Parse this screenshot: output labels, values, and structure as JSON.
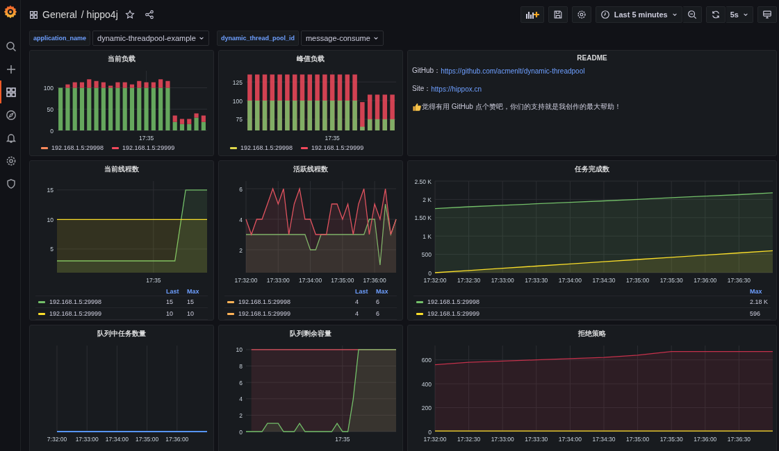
{
  "sidebar": {
    "items": [
      {
        "kind": "search",
        "selected": false
      },
      {
        "kind": "create",
        "selected": false
      },
      {
        "kind": "dashboards",
        "selected": true
      },
      {
        "kind": "explore",
        "selected": false
      },
      {
        "kind": "alerting",
        "selected": false
      },
      {
        "kind": "configuration",
        "selected": false
      },
      {
        "kind": "admin",
        "selected": false
      }
    ]
  },
  "breadcrumb": [
    "General",
    "/ hippo4j"
  ],
  "time_picker": {
    "label": "Last 5 minutes"
  },
  "refresh": {
    "interval": "5s"
  },
  "variables": [
    {
      "label": "application_name",
      "value": "dynamic-threadpool-example"
    },
    {
      "label": "dynamic_thread_pool_id",
      "value": "message-consume"
    }
  ],
  "panels": [
    {
      "kind": "chart",
      "title": "当前负载",
      "chart_data": {
        "type": "bar",
        "grid": true,
        "stacked": true,
        "categories": [
          null,
          null,
          null,
          null,
          null,
          null,
          null,
          null,
          null,
          null,
          null,
          null,
          "17:35",
          null,
          null,
          null,
          null,
          null,
          null,
          null,
          null
        ],
        "ylim": [
          0,
          140
        ],
        "yticks": [
          0,
          50,
          100
        ],
        "series": [
          {
            "name": "192.168.1.5:29998",
            "color": "#73bf69",
            "values": [
              100,
              100,
              100,
              100,
              100,
              100,
              100,
              100,
              100,
              100,
              100,
              100,
              100,
              100,
              100,
              100,
              20,
              15,
              15,
              30,
              20
            ]
          },
          {
            "name": "192.168.1.5:29999",
            "color": "#f2495c",
            "values": [
              0,
              8,
              13,
              13,
              20,
              16,
              13,
              5,
              13,
              13,
              8,
              16,
              13,
              13,
              20,
              16,
              15,
              12,
              12,
              10,
              15
            ]
          }
        ]
      },
      "legend": {
        "kind": "inline",
        "items": [
          {
            "color": "#ff8a5c"
          },
          {
            "color": "#f2495c"
          }
        ]
      }
    },
    {
      "kind": "chart",
      "title": "峰值负载",
      "chart_data": {
        "type": "bar",
        "grid": true,
        "stacked": false,
        "categories": [
          null,
          null,
          null,
          null,
          null,
          null,
          null,
          null,
          null,
          null,
          null,
          "17:35",
          null,
          null,
          null,
          null,
          null,
          null,
          null,
          null
        ],
        "ylim": [
          60,
          140
        ],
        "yticks": [
          75,
          100,
          125
        ],
        "series": [
          {
            "name": "192.168.1.5:29998",
            "color": "#73bf69",
            "values": [
              100,
              100,
              100,
              100,
              100,
              100,
              100,
              100,
              100,
              100,
              100,
              100,
              100,
              100,
              100,
              65,
              75,
              75,
              75,
              75
            ]
          },
          {
            "name": "192.168.1.5:29999",
            "color": "#f2495c",
            "values": [
              135,
              135,
              135,
              135,
              135,
              135,
              135,
              135,
              135,
              135,
              135,
              135,
              135,
              135,
              135,
              98,
              108,
              108,
              108,
              108
            ]
          }
        ]
      },
      "legend": {
        "kind": "inline",
        "items": [
          {
            "color": "#e0d84a"
          },
          {
            "color": "#f2495c"
          }
        ]
      }
    },
    {
      "kind": "text",
      "title": "README",
      "lines": [
        {
          "kind": "link",
          "label": "GitHub：",
          "link": "https://github.com/acmenlt/dynamic-threadpool"
        },
        {
          "kind": "link",
          "label": "Site：",
          "link": "https://hippox.cn"
        },
        {
          "kind": "note",
          "text": "觉得有用 GitHub 点个赞吧，你们的支持就是我创作的最大帮助！"
        }
      ]
    },
    {
      "kind": "chart",
      "title": "当前线程数",
      "chart_data": {
        "type": "area",
        "grid": true,
        "categories": [
          null,
          null,
          null,
          null,
          null,
          null,
          null,
          null,
          null,
          "17:35",
          null,
          null,
          null,
          null,
          null
        ],
        "ylim": [
          1,
          16.5
        ],
        "yticks": [
          5,
          10,
          15
        ],
        "series": [
          {
            "name": "192.168.1.5:29998",
            "color": "#73bf69",
            "values": [
              3,
              3,
              3,
              3,
              3,
              3,
              3,
              3,
              3,
              3,
              3,
              3,
              15,
              15,
              15
            ]
          },
          {
            "name": "192.168.1.5:29999",
            "color": "#fade2a",
            "values": [
              10,
              10,
              10,
              10,
              10,
              10,
              10,
              10,
              10,
              10,
              10,
              10,
              10,
              10,
              10
            ]
          }
        ]
      },
      "legend": {
        "kind": "table",
        "columns": [
          "Last",
          "Max"
        ],
        "items": [
          {
            "color": "#73bf69",
            "values": [
              "15",
              "15"
            ]
          },
          {
            "color": "#fade2a",
            "values": [
              "10",
              "10"
            ]
          }
        ]
      }
    },
    {
      "kind": "chart",
      "title": "活跃线程数",
      "chart_data": {
        "type": "area",
        "grid": true,
        "categories": [
          "17:32:00",
          null,
          null,
          null,
          null,
          null,
          "17:33:00",
          null,
          null,
          null,
          null,
          null,
          "17:34:00",
          null,
          null,
          null,
          null,
          null,
          "17:35:00",
          null,
          null,
          null,
          null,
          null,
          "17:36:00",
          null,
          null,
          null,
          null
        ],
        "ylim": [
          0.5,
          6.5
        ],
        "yticks": [
          2,
          4,
          6
        ],
        "series": [
          {
            "name": "192.168.1.5:29998",
            "color": "#73bf69",
            "values": [
              3,
              3,
              3,
              3,
              3,
              3,
              3,
              3,
              3,
              3,
              3,
              3,
              2,
              2,
              3,
              3,
              3,
              3,
              3,
              3,
              3,
              3,
              3,
              4,
              4,
              1,
              5,
              3,
              4
            ]
          },
          {
            "name": "192.168.1.5:29999",
            "color": "#e0535f",
            "values": [
              4,
              3,
              4,
              4,
              5,
              6,
              5,
              6,
              3,
              5,
              6,
              4,
              4,
              3,
              3,
              3,
              5,
              5,
              4,
              5,
              3,
              5,
              6,
              3,
              5,
              4,
              6,
              3,
              4
            ]
          }
        ]
      },
      "legend": {
        "kind": "table",
        "columns": [
          "Last",
          "Max"
        ],
        "items": [
          {
            "color": "#ffb357",
            "values": [
              "4",
              "6"
            ]
          },
          {
            "color": "#ffb357",
            "values": [
              "4",
              "6"
            ]
          }
        ]
      }
    },
    {
      "kind": "chart",
      "title": "任务完成数",
      "chart_data": {
        "type": "area",
        "grid": true,
        "categories": [
          "17:32:00",
          "17:32:30",
          "17:33:00",
          "17:33:30",
          "17:34:00",
          "17:34:30",
          "17:35:00",
          "17:35:30",
          "17:36:00",
          "17:36:30",
          null
        ],
        "ylim": [
          0,
          2500
        ],
        "yticks": [
          0,
          500,
          {
            "value": 1000,
            "label": "1 K"
          },
          {
            "value": 1500,
            "label": "1.50 K"
          },
          {
            "value": 2000,
            "label": "2 K"
          },
          {
            "value": 2500,
            "label": "2.50 K"
          }
        ],
        "series": [
          {
            "name": "192.168.1.5:29998",
            "color": "#73bf69",
            "values": [
              1750,
              1800,
              1840,
              1880,
              1920,
              1960,
              2000,
              2050,
              2090,
              2130,
              2180
            ]
          },
          {
            "name": "192.168.1.5:29999",
            "color": "#fade2a",
            "values": [
              0,
              60,
              120,
              180,
              240,
              300,
              360,
              420,
              480,
              540,
              600
            ]
          }
        ]
      },
      "legend": {
        "kind": "table",
        "columns": [
          "Max"
        ],
        "items": [
          {
            "color": "#73bf69",
            "values": [
              "2.18 K"
            ]
          },
          {
            "color": "#fade2a",
            "values": [
              "596"
            ]
          }
        ]
      }
    },
    {
      "kind": "plain",
      "title": "队列中任务数量",
      "x_labels": [
        "7:32:00",
        "17:33:00",
        "17:34:00",
        "17:35:00",
        "17:36:00"
      ]
    },
    {
      "kind": "chart",
      "title": "队列剩余容量",
      "chart_data": {
        "type": "area",
        "grid": true,
        "categories": [
          null,
          null,
          null,
          null,
          null,
          null,
          null,
          null,
          null,
          null,
          null,
          null,
          null,
          null,
          null,
          null,
          null,
          null,
          "17:35",
          null,
          null,
          null,
          null,
          null,
          null,
          null,
          null,
          null,
          null
        ],
        "ylim": [
          0,
          10.5
        ],
        "yticks": [
          0,
          2,
          4,
          6,
          8,
          10
        ],
        "series": [
          {
            "color": "#e0535f",
            "values": [
              null,
              10,
              10,
              10,
              10,
              10,
              10,
              10,
              10,
              10,
              10,
              10,
              10,
              10,
              10,
              10,
              10,
              10,
              10,
              10,
              10,
              10,
              10,
              10,
              10,
              10,
              10,
              10,
              10
            ]
          },
          {
            "color": "#73bf69",
            "values": [
              0,
              0,
              0,
              0,
              1,
              1,
              1,
              0,
              0,
              0,
              1,
              0,
              0,
              0,
              0,
              0,
              0,
              1,
              0,
              0,
              4,
              10,
              10,
              10,
              10,
              10,
              10,
              10,
              10
            ]
          }
        ]
      }
    },
    {
      "kind": "chart",
      "title": "拒绝策略",
      "chart_data": {
        "type": "area",
        "grid": true,
        "categories": [
          "17:32:00",
          "17:32:30",
          "17:33:00",
          "17:33:30",
          "17:34:00",
          "17:34:30",
          "17:35:00",
          "17:35:30",
          "17:36:00",
          "17:36:30",
          null
        ],
        "ylim": [
          0,
          720
        ],
        "yticks": [
          0,
          200,
          400,
          600
        ],
        "series": [
          {
            "color": "#c4314b",
            "values": [
              560,
              580,
              590,
              600,
              610,
              620,
              640,
              670,
              670,
              670,
              670
            ]
          },
          {
            "color": "#fade2a",
            "values": [
              5,
              5,
              5,
              5,
              5,
              5,
              5,
              5,
              5,
              5,
              5
            ]
          }
        ]
      }
    }
  ]
}
